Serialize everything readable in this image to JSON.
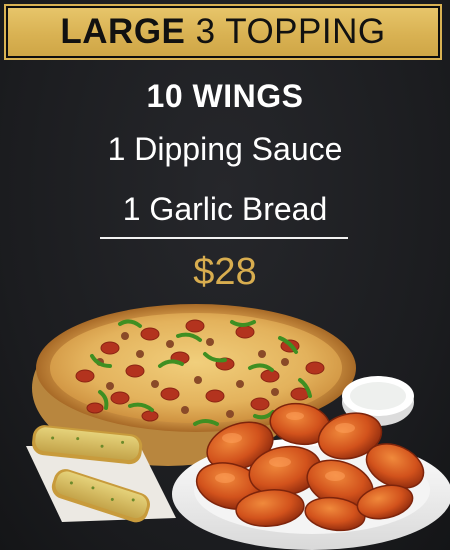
{
  "banner": {
    "bold_text": "LARGE",
    "rest_text": "3 TOPPING"
  },
  "lines": {
    "wings": "10 WINGS",
    "sauce": "1 Dipping Sauce",
    "bread": "1 Garlic Bread"
  },
  "price": "$28",
  "colors": {
    "background": "#1d1e21",
    "banner": "#d9b253",
    "price": "#d8ad4f",
    "text": "#ffffff"
  },
  "images": {
    "pizza": "pizza-image",
    "garlic_bread": "garlic-bread-image",
    "wings": "chicken-wings-image",
    "sauce": "dipping-sauce-image"
  }
}
